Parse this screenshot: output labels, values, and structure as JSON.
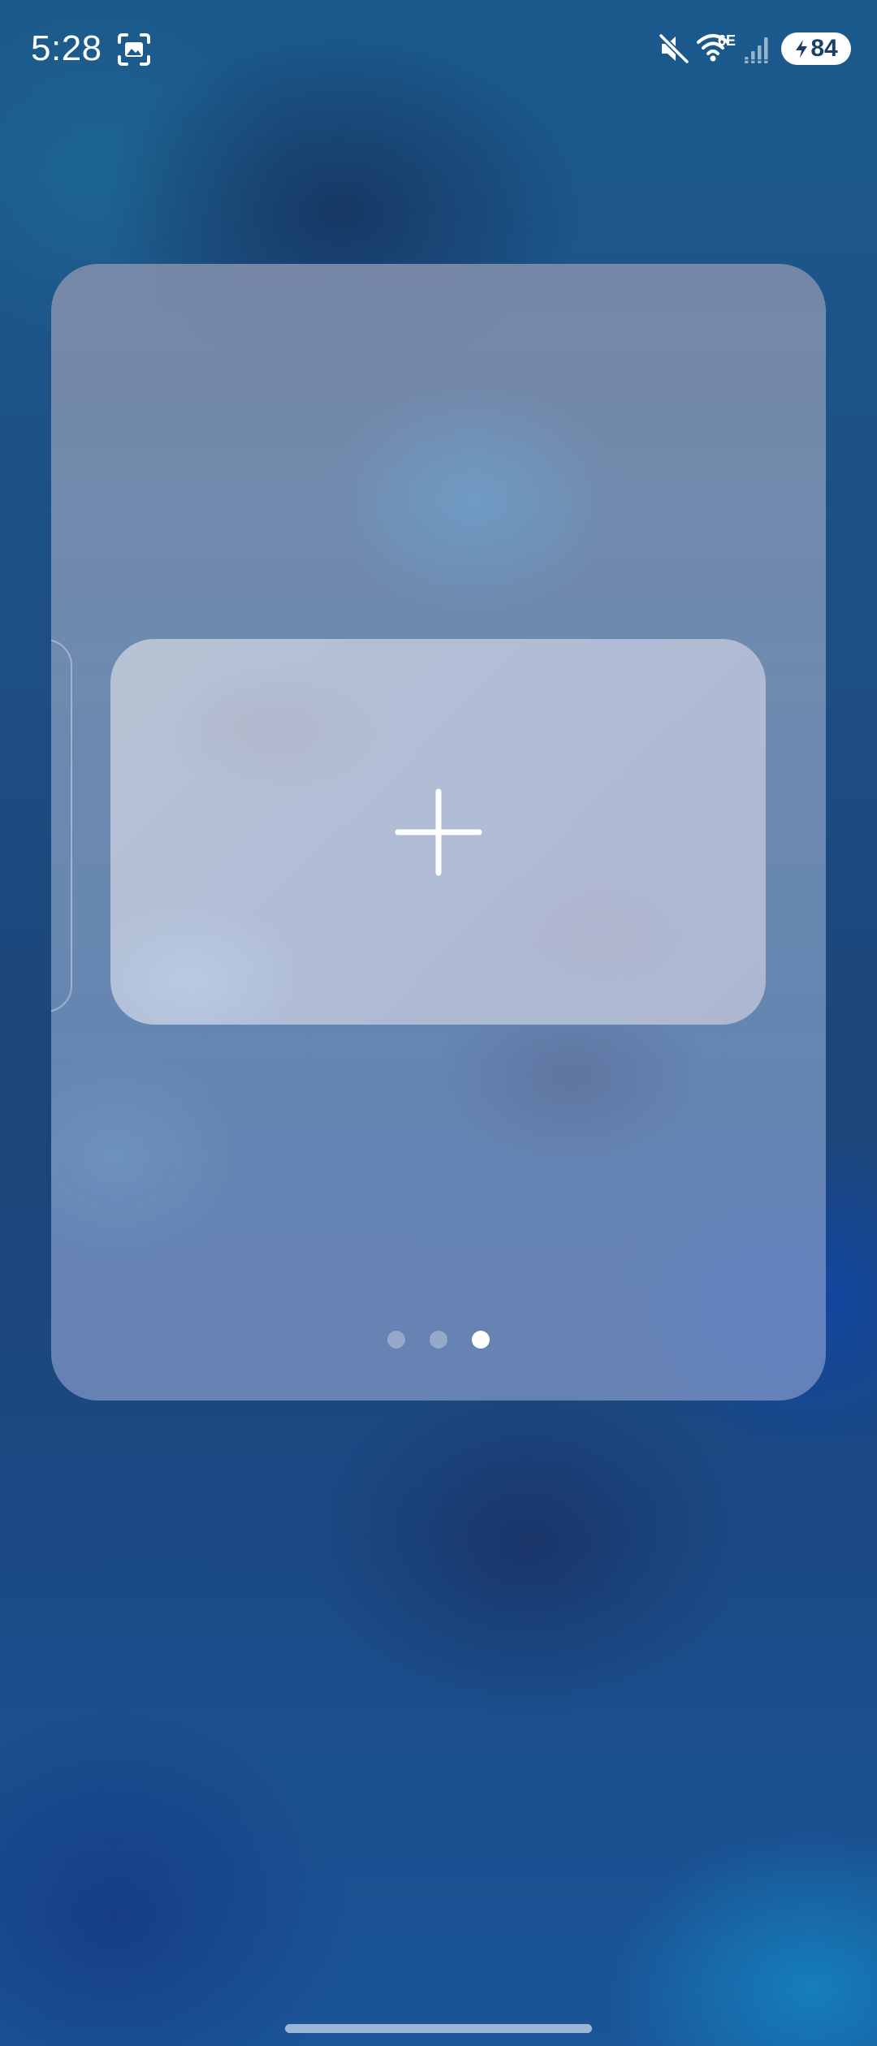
{
  "status_bar": {
    "time": "5:28",
    "network_label": "6E",
    "battery_level": "84",
    "icons": [
      "screenshot-icon",
      "mute-icon",
      "wifi-icon",
      "signal-icon",
      "battery-charging-icon"
    ]
  },
  "widget_panel": {
    "add_card_icon": "plus-icon",
    "pages": {
      "count": 3,
      "active_index": 2
    }
  },
  "colors": {
    "panel_background": "#7d8cab",
    "add_card_background": "#b0bcd5",
    "active_dot": "#ffffff",
    "inactive_dot": "#aab4c8"
  }
}
